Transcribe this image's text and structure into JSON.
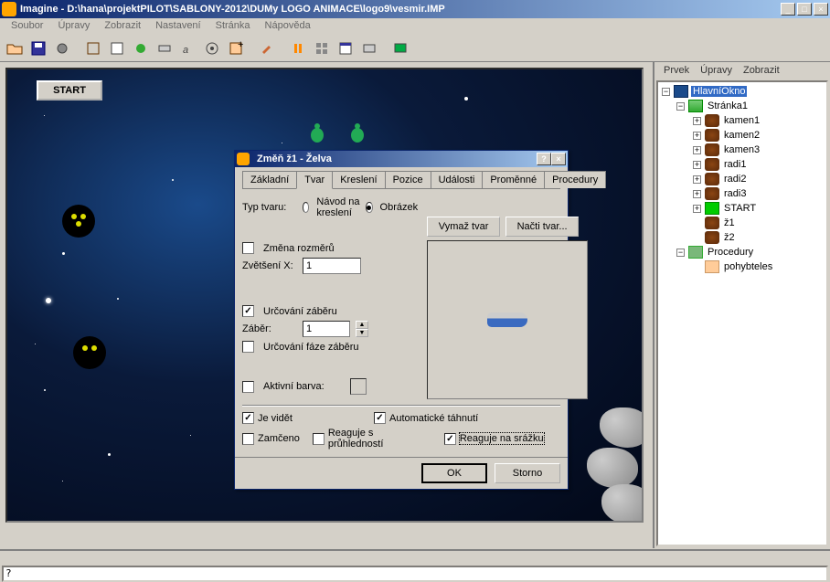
{
  "title": "Imagine - D:\\hana\\projektPILOT\\SABLONY-2012\\DUMy LOGO ANIMACE\\logo9\\vesmir.IMP",
  "menubar": [
    "Soubor",
    "Úpravy",
    "Zobrazit",
    "Nastavení",
    "Stránka",
    "Nápověda"
  ],
  "start_button": "START",
  "command_prompt": "?",
  "side_menu": [
    "Prvek",
    "Úpravy",
    "Zobrazit"
  ],
  "tree": {
    "root": "HlavníOkno",
    "page": "Stránka1",
    "items": [
      "kamen1",
      "kamen2",
      "kamen3",
      "radi1",
      "radi2",
      "radi3",
      "START",
      "ž1",
      "ž2"
    ],
    "proc_folder": "Procedury",
    "proc": "pohybteles"
  },
  "dialog": {
    "title": "Změň ž1  - Želva",
    "tabs": [
      "Základní",
      "Tvar",
      "Kreslení",
      "Pozice",
      "Události",
      "Proměnné",
      "Procedury"
    ],
    "active_tab": 1,
    "type_label": "Typ tvaru:",
    "radio_draw": "Návod na kreslení",
    "radio_image": "Obrázek",
    "btn_erase": "Vymaž tvar",
    "btn_load": "Načti tvar...",
    "chk_resize": "Změna rozměrů",
    "zoom_label": "Zvětšení X:",
    "zoom_value": "1",
    "chk_frame": "Určování záběru",
    "frame_label": "Záběr:",
    "frame_value": "1",
    "chk_phase": "Určování fáze záběru",
    "chk_active_color": "Aktivní barva:",
    "chk_visible": "Je vidět",
    "chk_auto_drag": "Automatické táhnutí",
    "chk_locked": "Zamčeno",
    "chk_transparency": "Reaguje s průhledností",
    "chk_collision": "Reaguje na srážku",
    "btn_ok": "OK",
    "btn_cancel": "Storno"
  },
  "window_controls": {
    "min": "_",
    "max": "□",
    "close": "×",
    "help": "?"
  }
}
